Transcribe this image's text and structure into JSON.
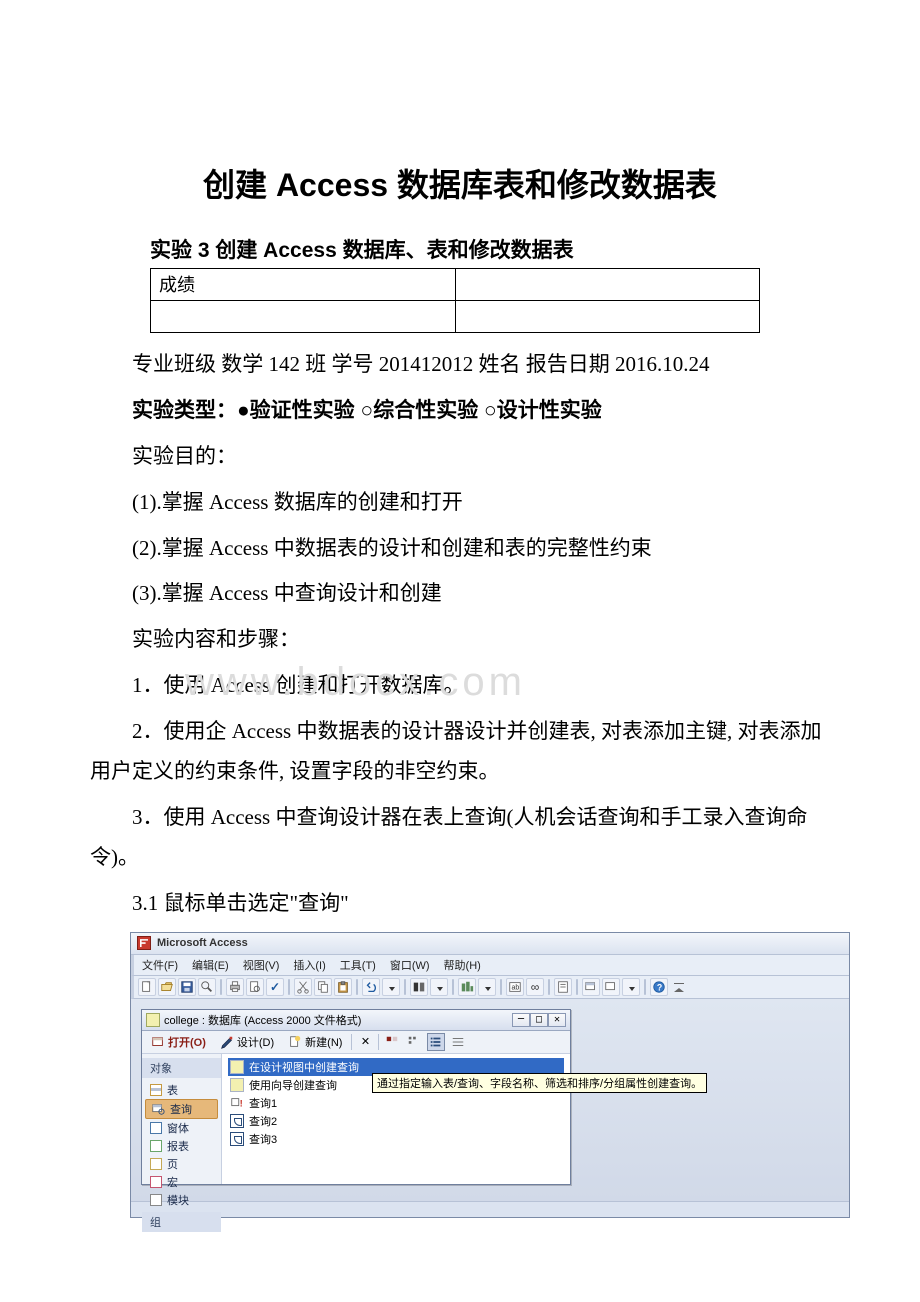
{
  "doc": {
    "title": "创建 Access 数据库表和修改数据表",
    "subtitle": "实验 3 创建 Access 数据库、表和修改数据表",
    "grade_label": "成绩",
    "info_line": "专业班级 数学 142 班  学号 201412012 姓名   报告日期 2016.10.24",
    "exp_type_label": "实验类型：",
    "exp_type_options": "●验证性实验 ○综合性实验 ○设计性实验",
    "purpose_label": "实验目的：",
    "purpose_1": "(1).掌握 Access 数据库的创建和打开",
    "purpose_2": "(2).掌握 Access 中数据表的设计和创建和表的完整性约束",
    "purpose_3": "(3).掌握 Access 中查询设计和创建",
    "steps_label": "实验内容和步骤：",
    "step_1": "1．使用 Access 创建和打开数据库。",
    "step_2": "2．使用企 Access 中数据表的设计器设计并创建表, 对表添加主键, 对表添加用户定义的约束条件, 设置字段的非空约束。",
    "step_3": "3．使用 Access 中查询设计器在表上查询(人机会话查询和手工录入查询命令)。",
    "step_3_1": "3.1 鼠标单击选定\"查询\"",
    "watermark": "www.bdocx.com"
  },
  "shot": {
    "app_title": "Microsoft Access",
    "menu": {
      "file": "文件(F)",
      "edit": "编辑(E)",
      "view": "视图(V)",
      "insert": "插入(I)",
      "tools": "工具(T)",
      "window": "窗口(W)",
      "help": "帮助(H)"
    },
    "db_title": "college : 数据库 (Access 2000 文件格式)",
    "db_toolbar": {
      "open": "打开(O)",
      "design": "设计(D)",
      "new": "新建(N)"
    },
    "side": {
      "objects": "对象",
      "tables": "表",
      "queries": "查询",
      "forms": "窗体",
      "reports": "报表",
      "pages": "页",
      "macros": "宏",
      "modules": "模块",
      "groups": "组"
    },
    "main": {
      "row1": "在设计视图中创建查询",
      "row2": "使用向导创建查询",
      "tooltip": "通过指定输入表/查询、字段名称、筛选和排序/分组属性创建查询。",
      "q1": "查询1",
      "q2": "查询2",
      "q3": "查询3"
    }
  }
}
